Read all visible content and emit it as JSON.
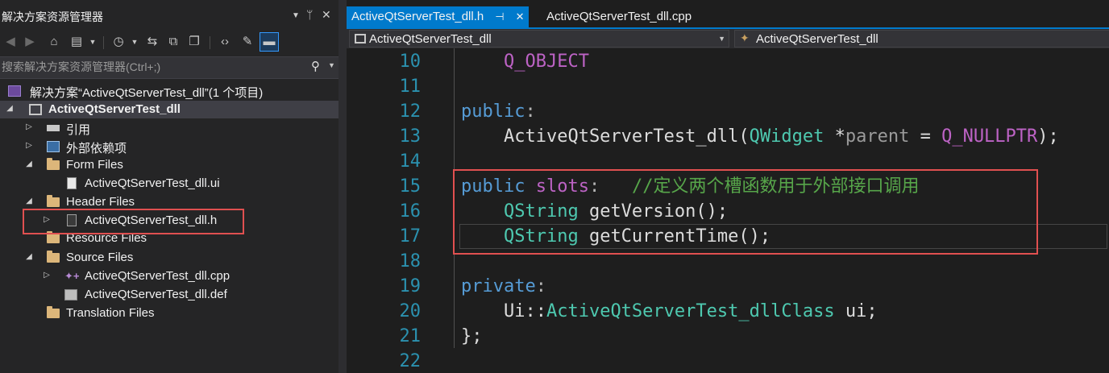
{
  "solution_explorer": {
    "title": "解决方案资源管理器",
    "title_controls": {
      "dropdown": "▼",
      "pin": "ᛘ",
      "close": "✕"
    },
    "toolbar": [
      "back-icon",
      "forward-icon",
      "home-icon",
      "switch-views-icon",
      "history-icon",
      "sync-icon",
      "collapse-all-icon",
      "show-all-files-icon",
      "view-code-icon",
      "properties-icon",
      "preview-icon"
    ],
    "search": {
      "placeholder": "搜索解决方案资源管理器(Ctrl+;)"
    },
    "tree": [
      {
        "label": "解决方案“ActiveQtServerTest_dll”(1 个项目)",
        "icon": "solution-icon",
        "level": 0,
        "expander": ""
      },
      {
        "label": "ActiveQtServerTest_dll",
        "icon": "project-icon",
        "level": 0,
        "expander": "expanded",
        "bold": true,
        "highlighted": true
      },
      {
        "label": "引用",
        "icon": "references-icon",
        "level": 1,
        "expander": "collapsed"
      },
      {
        "label": "外部依赖项",
        "icon": "external-deps-icon",
        "level": 1,
        "expander": "collapsed"
      },
      {
        "label": "Form Files",
        "icon": "folder-icon",
        "level": 1,
        "expander": "expanded"
      },
      {
        "label": "ActiveQtServerTest_dll.ui",
        "icon": "ui-file-icon",
        "level": 2,
        "expander": ""
      },
      {
        "label": "Header Files",
        "icon": "folder-icon",
        "level": 1,
        "expander": "expanded"
      },
      {
        "label": "ActiveQtServerTest_dll.h",
        "icon": "header-file-icon",
        "level": 2,
        "expander": "collapsed"
      },
      {
        "label": "Resource Files",
        "icon": "folder-icon",
        "level": 1,
        "expander": ""
      },
      {
        "label": "Source Files",
        "icon": "folder-icon",
        "level": 1,
        "expander": "expanded"
      },
      {
        "label": "ActiveQtServerTest_dll.cpp",
        "icon": "cpp-file-icon",
        "level": 2,
        "expander": "collapsed"
      },
      {
        "label": "ActiveQtServerTest_dll.def",
        "icon": "def-file-icon",
        "level": 2,
        "expander": ""
      },
      {
        "label": "Translation Files",
        "icon": "folder-icon",
        "level": 1,
        "expander": ""
      }
    ]
  },
  "editor": {
    "tabs": [
      {
        "label": "ActiveQtServerTest_dll.h",
        "active": true,
        "pin": "⊣",
        "close": "✕"
      },
      {
        "label": "ActiveQtServerTest_dll.cpp",
        "active": false
      }
    ],
    "nav": {
      "project": "ActiveQtServerTest_dll",
      "scope": "ActiveQtServerTest_dll"
    },
    "lines": [
      {
        "n": "10",
        "tokens": [
          {
            "t": "    ",
            "c": ""
          },
          {
            "t": "Q_OBJECT",
            "c": "mc"
          }
        ]
      },
      {
        "n": "11",
        "tokens": []
      },
      {
        "n": "12",
        "tokens": [
          {
            "t": "public",
            "c": "kw"
          },
          {
            "t": ":",
            "c": "pu"
          }
        ]
      },
      {
        "n": "13",
        "tokens": [
          {
            "t": "    ActiveQtServerTest_dll(",
            "c": ""
          },
          {
            "t": "QWidget",
            "c": "ty"
          },
          {
            "t": " *",
            "c": ""
          },
          {
            "t": "parent",
            "c": "pr"
          },
          {
            "t": " = ",
            "c": ""
          },
          {
            "t": "Q_NULLPTR",
            "c": "mc"
          },
          {
            "t": ");",
            "c": ""
          }
        ]
      },
      {
        "n": "14",
        "tokens": []
      },
      {
        "n": "15",
        "tokens": [
          {
            "t": "public",
            "c": "kw"
          },
          {
            "t": " ",
            "c": ""
          },
          {
            "t": "slots",
            "c": "mc"
          },
          {
            "t": ":   ",
            "c": "pu"
          },
          {
            "t": "//定义两个槽函数用于外部接口调用",
            "c": "cm"
          }
        ]
      },
      {
        "n": "16",
        "tokens": [
          {
            "t": "    ",
            "c": ""
          },
          {
            "t": "QString",
            "c": "ty"
          },
          {
            "t": " getVersion();",
            "c": ""
          }
        ]
      },
      {
        "n": "17",
        "tokens": [
          {
            "t": "    ",
            "c": ""
          },
          {
            "t": "QString",
            "c": "ty"
          },
          {
            "t": " getCurrentTime();",
            "c": ""
          }
        ]
      },
      {
        "n": "18",
        "tokens": []
      },
      {
        "n": "19",
        "tokens": [
          {
            "t": "private",
            "c": "kw"
          },
          {
            "t": ":",
            "c": "pu"
          }
        ]
      },
      {
        "n": "20",
        "tokens": [
          {
            "t": "    Ui::",
            "c": ""
          },
          {
            "t": "ActiveQtServerTest_dllClass",
            "c": "ty"
          },
          {
            "t": " ui;",
            "c": ""
          }
        ]
      },
      {
        "n": "21",
        "tokens": [
          {
            "t": "};",
            "c": ""
          }
        ]
      },
      {
        "n": "22",
        "tokens": []
      }
    ]
  },
  "colors": {
    "accent": "#007acc",
    "annotation_box": "#e05050",
    "keyword": "#569cd6",
    "type": "#4ec9b0",
    "macro": "#bd63c5",
    "comment": "#57a64a",
    "line_number": "#2b91af"
  }
}
